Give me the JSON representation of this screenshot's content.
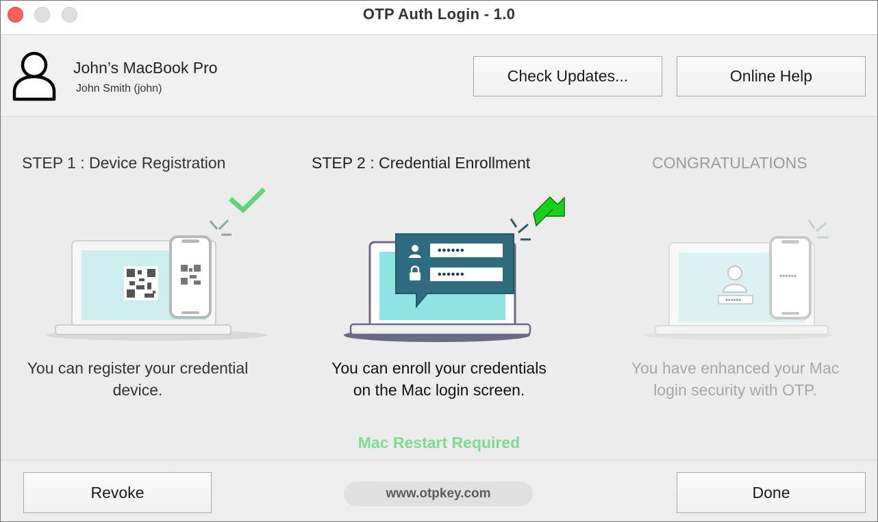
{
  "window": {
    "title": "OTP Auth Login - 1.0"
  },
  "header": {
    "device_name": "John’s MacBook Pro",
    "user_name": "John Smith (john)",
    "check_updates_label": "Check Updates...",
    "online_help_label": "Online Help"
  },
  "steps": [
    {
      "title": "STEP 1 : Device Registration",
      "description": "You can register your credential device.",
      "status": "completed"
    },
    {
      "title": "STEP 2 : Credential Enrollment",
      "description": "You can enroll your credentials on the Mac login screen.",
      "status": "current",
      "password_mask": "••••••",
      "note": "Mac Restart Required"
    },
    {
      "title": "CONGRATULATIONS",
      "description": "You have enhanced your Mac login security with OTP.",
      "status": "pending",
      "password_mask": "••••••"
    }
  ],
  "footer": {
    "revoke_label": "Revoke",
    "website": "www.otpkey.com",
    "done_label": "Done"
  },
  "colors": {
    "close_button": "#fe5f57",
    "check_green": "#5fd47a",
    "arrow_green": "#16d21a",
    "restart_text": "#7ddc8f",
    "dialog_blue": "#2f6c80",
    "screen_cyan": "#8fe3e3"
  }
}
